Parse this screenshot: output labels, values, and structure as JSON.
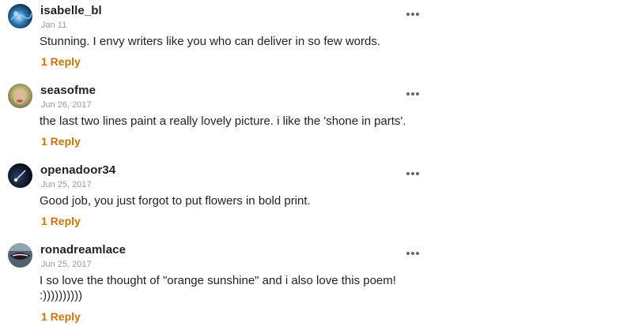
{
  "comments": [
    {
      "avatar_icon": "avatar-blue-water-icon",
      "username": "isabelle_bl",
      "date": "Jan 11",
      "text": "Stunning. I envy writers like you who can deliver in so few words.",
      "reply_label": "1 Reply"
    },
    {
      "avatar_icon": "avatar-face-photo-icon",
      "username": "seasofme",
      "date": "Jun 26, 2017",
      "text": "the last two lines paint a really lovely picture. i like the 'shone in parts'.",
      "reply_label": "1 Reply"
    },
    {
      "avatar_icon": "avatar-night-comet-icon",
      "username": "openadoor34",
      "date": "Jun 25, 2017",
      "text": "Good job, you just forgot to put flowers in bold print.",
      "reply_label": "1 Reply"
    },
    {
      "avatar_icon": "avatar-lips-icon",
      "username": "ronadreamlace",
      "date": "Jun 25, 2017",
      "text": "I so love the thought of \"orange sunshine\" and i also love this poem! :))))))))))",
      "reply_label": "1 Reply"
    }
  ],
  "colors": {
    "reply_accent": "#c8750c",
    "date_gray": "#9a9a9a",
    "text": "#222222",
    "more_icon": "#666666"
  },
  "icons": {
    "more": "more-horizontal-icon"
  }
}
